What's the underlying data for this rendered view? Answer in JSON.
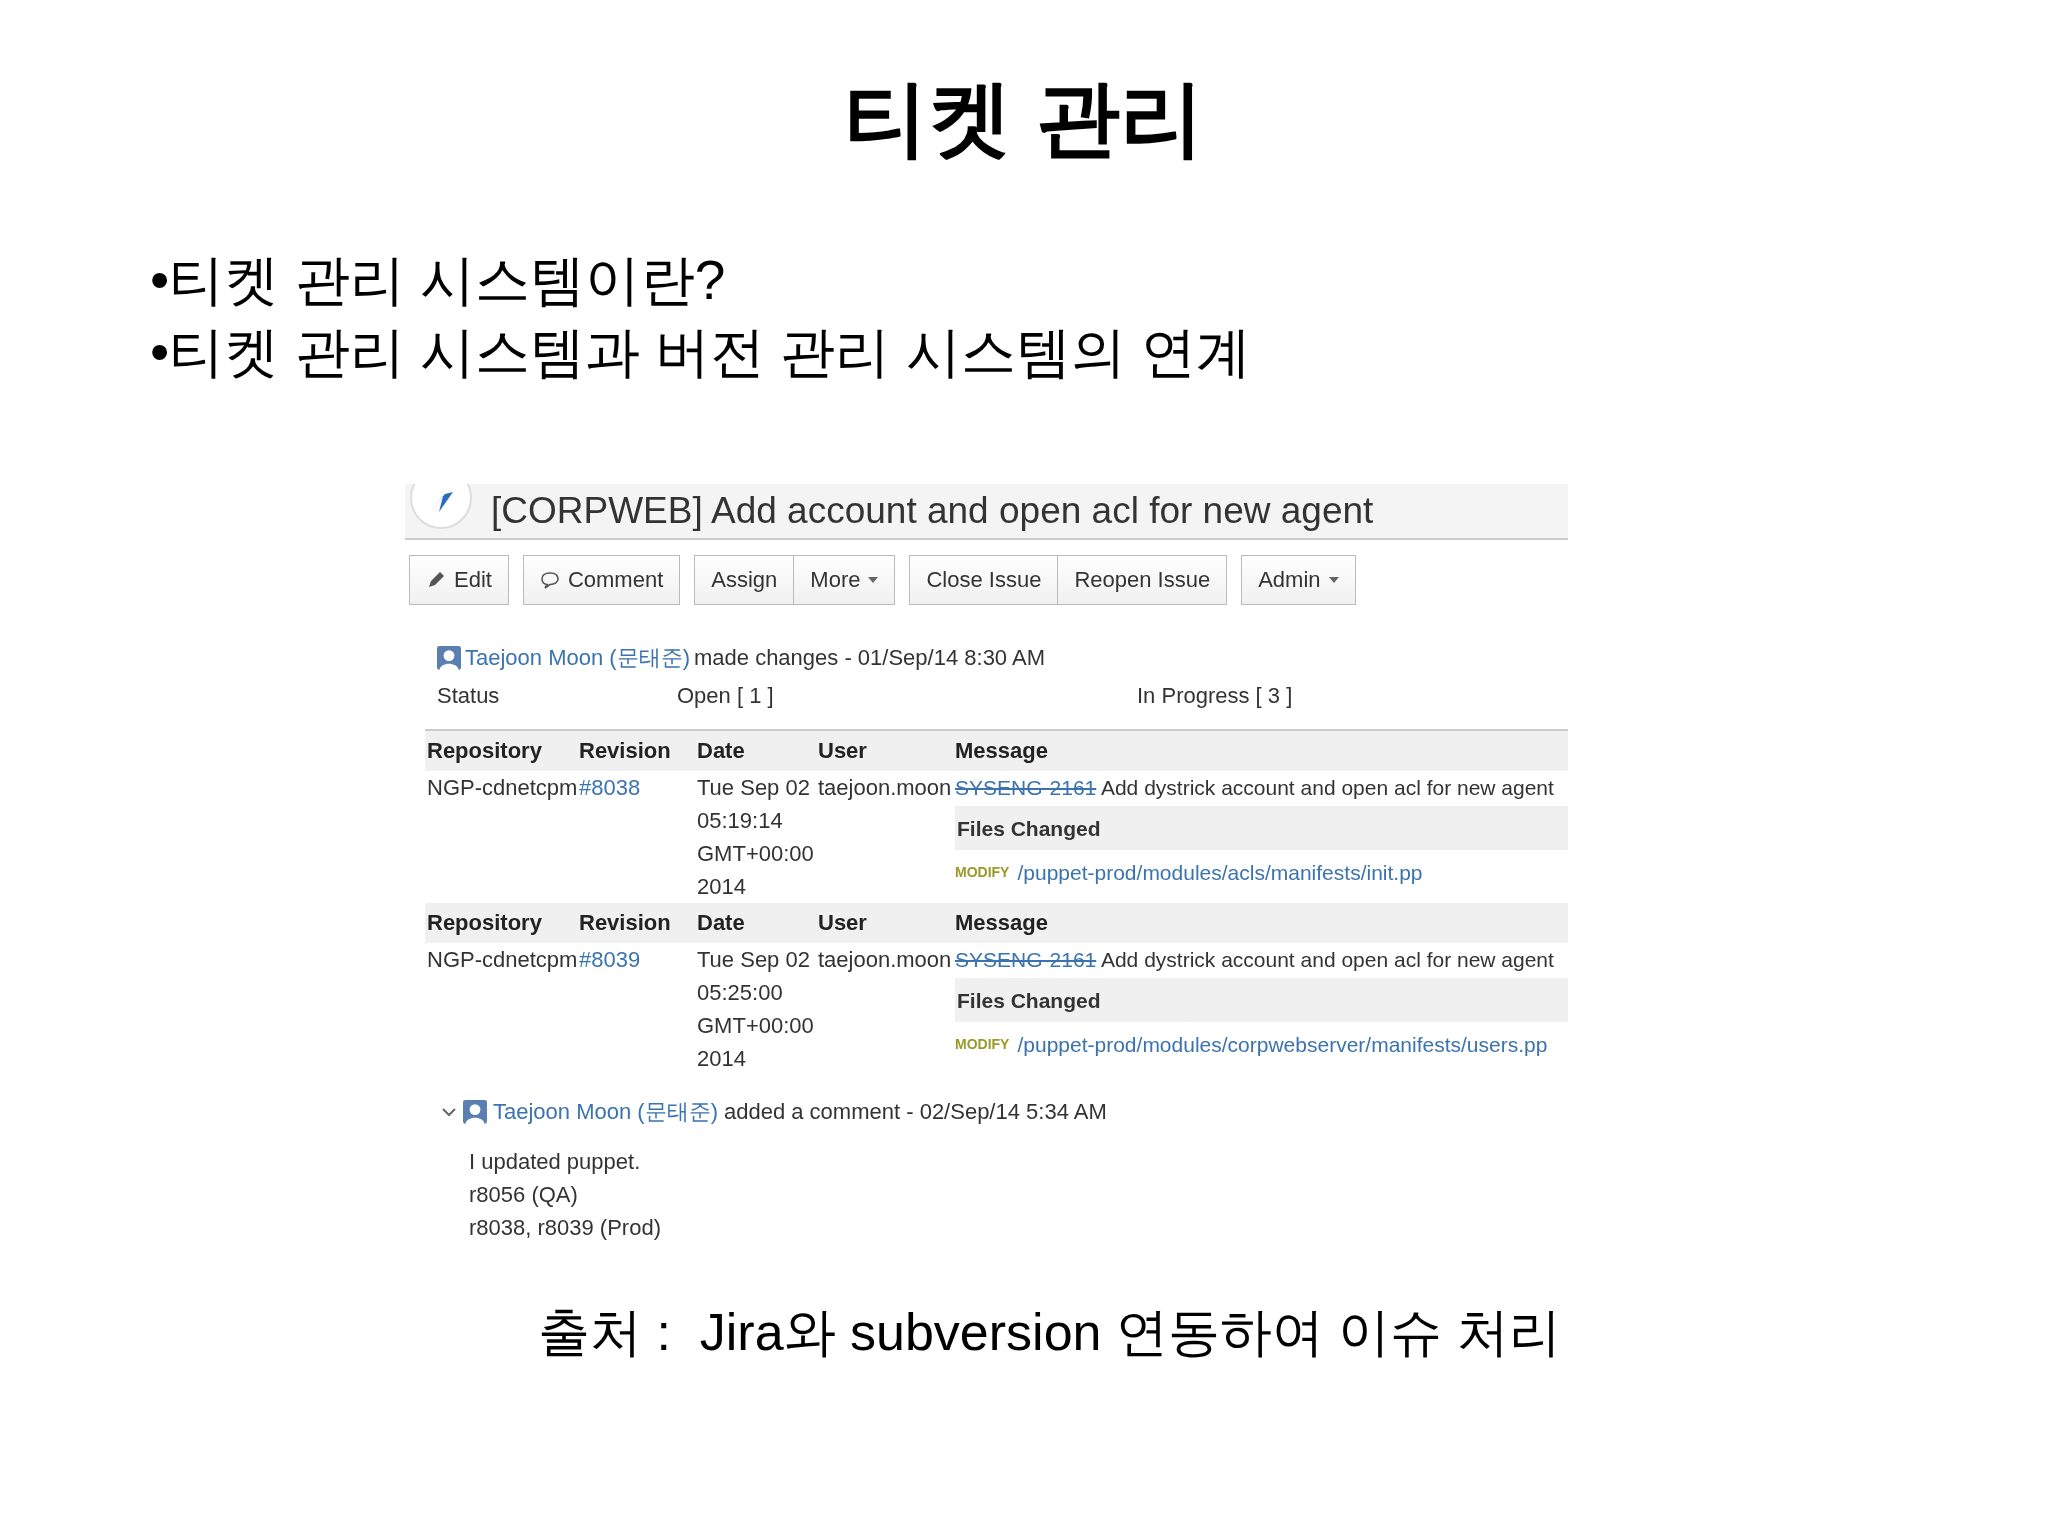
{
  "title": "티켓 관리",
  "bullets": [
    "•티켓 관리 시스템이란?",
    "•티켓 관리 시스템과 버전 관리 시스템의 연계"
  ],
  "issue": {
    "title": "[CORPWEB] Add account and open acl for new agent",
    "button_groups": [
      [
        {
          "label": "Edit",
          "kind": "edit"
        }
      ],
      [
        {
          "label": "Comment",
          "kind": "comment"
        }
      ],
      [
        {
          "label": "Assign",
          "kind": "plain"
        },
        {
          "label": "More",
          "kind": "dropdown"
        }
      ],
      [
        {
          "label": "Close Issue",
          "kind": "plain"
        },
        {
          "label": "Reopen Issue",
          "kind": "plain"
        }
      ],
      [
        {
          "label": "Admin",
          "kind": "dropdown"
        }
      ]
    ],
    "change": {
      "author": "Taejoon Moon (문태준)",
      "action": "made changes - 01/Sep/14 8:30 AM",
      "field": "Status",
      "from": "Open [ 1 ]",
      "to": "In Progress [ 3 ]"
    },
    "commits": [
      {
        "columns": [
          "Repository",
          "Revision",
          "Date",
          "User",
          "Message"
        ],
        "repository": "NGP-cdnetcpm",
        "revision": "#8038",
        "date_lines": [
          "Tue Sep 02",
          "05:19:14",
          "GMT+00:00",
          "2014"
        ],
        "user": "taejoon.moon",
        "issue_key": "SYSENG-2161",
        "resolved": true,
        "message": "Add dystrick account and open acl for new agent",
        "files_header": "Files Changed",
        "files": [
          {
            "action": "MODIFY",
            "path": "/puppet-prod/modules/acls/manifests/init.pp"
          }
        ]
      },
      {
        "columns": [
          "Repository",
          "Revision",
          "Date",
          "User",
          "Message"
        ],
        "repository": "NGP-cdnetcpm",
        "revision": "#8039",
        "date_lines": [
          "Tue Sep 02",
          "05:25:00",
          "GMT+00:00",
          "2014"
        ],
        "user": "taejoon.moon",
        "issue_key": "SYSENG-2161",
        "resolved": true,
        "message": "Add dystrick account and open acl for new agent",
        "files_header": "Files Changed",
        "files": [
          {
            "action": "MODIFY",
            "path": "/puppet-prod/modules/corpwebserver/manifests/users.pp"
          }
        ]
      }
    ],
    "comment": {
      "expanded": true,
      "author": "Taejoon Moon (문태준)",
      "action": "added a comment - 02/Sep/14 5:34 AM",
      "body_lines": [
        "I updated puppet.",
        "r8056 (QA)",
        "r8038, r8039 (Prod)"
      ]
    }
  },
  "caption": "출처 :  Jira와 subversion 연동하여 이슈 처리"
}
